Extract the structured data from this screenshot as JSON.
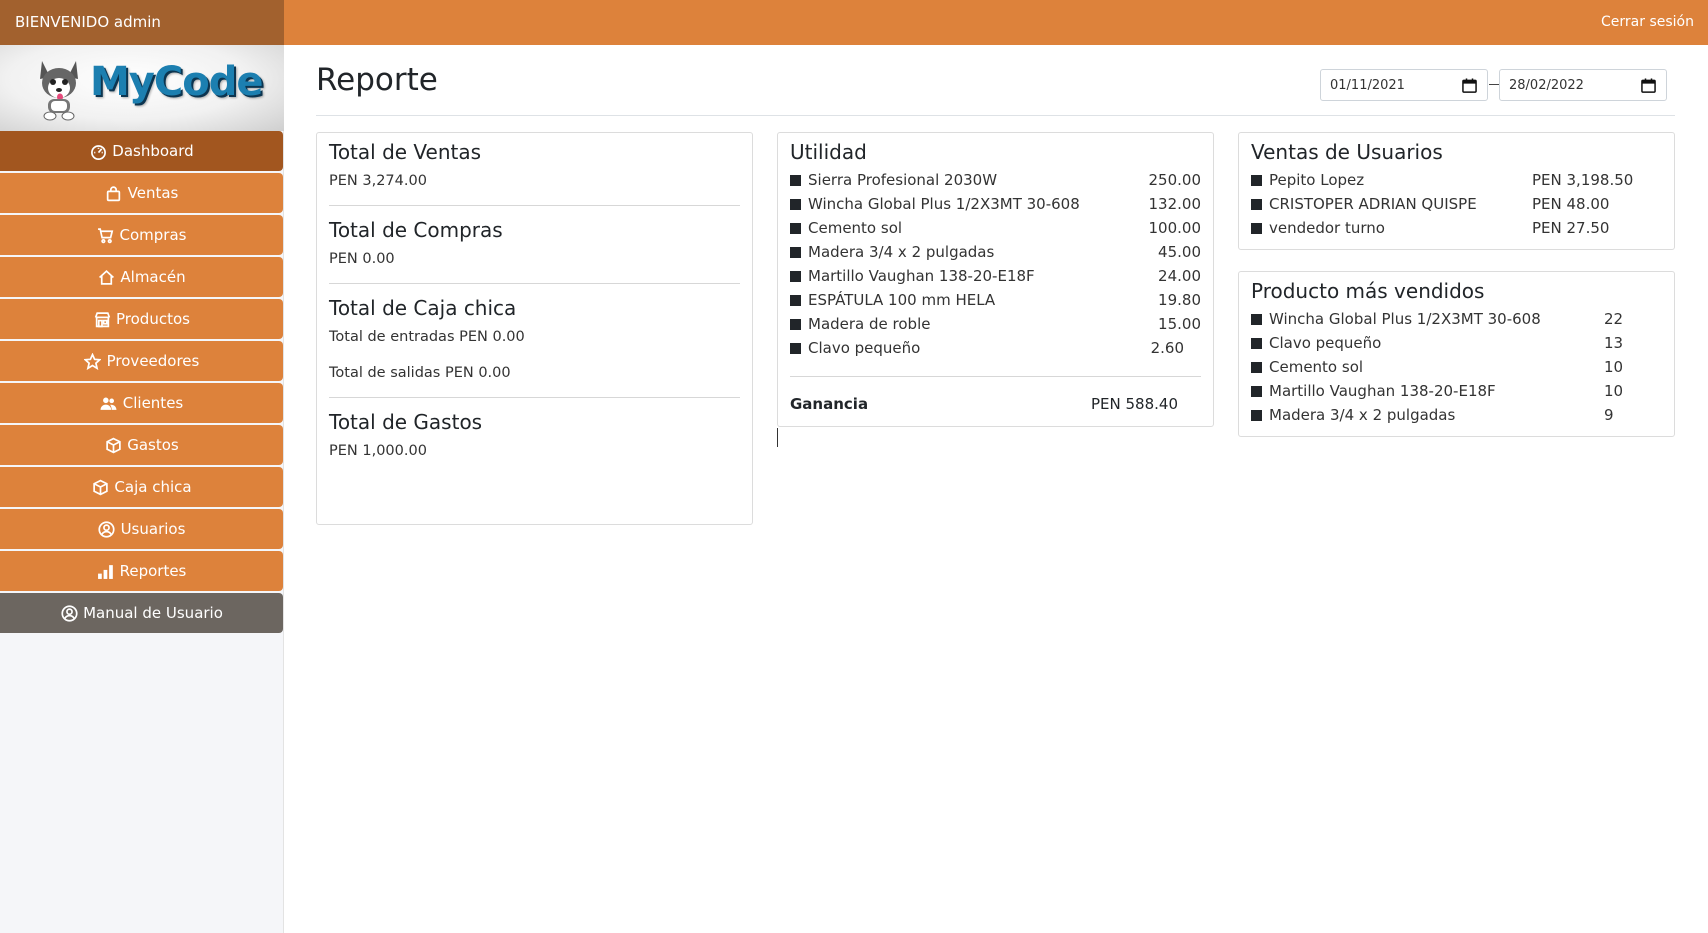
{
  "topbar": {
    "welcome": "BIENVENIDO admin",
    "logout": "Cerrar sesión"
  },
  "logo": {
    "text": "MyCode"
  },
  "sidebar": {
    "items": [
      {
        "label": "Dashboard",
        "icon": "dashboard-icon"
      },
      {
        "label": "Ventas",
        "icon": "bag-icon"
      },
      {
        "label": "Compras",
        "icon": "cart-icon"
      },
      {
        "label": "Almacén",
        "icon": "house-icon"
      },
      {
        "label": "Productos",
        "icon": "shop-icon"
      },
      {
        "label": "Proveedores",
        "icon": "star-icon"
      },
      {
        "label": "Clientes",
        "icon": "people-icon"
      },
      {
        "label": "Gastos",
        "icon": "box-icon"
      },
      {
        "label": "Caja chica",
        "icon": "box-icon"
      },
      {
        "label": "Usuarios",
        "icon": "person-circle-icon"
      },
      {
        "label": "Reportes",
        "icon": "bar-chart-icon"
      },
      {
        "label": "Manual de Usuario",
        "icon": "person-circle-icon"
      }
    ]
  },
  "page": {
    "title": "Reporte",
    "date_from": "01/11/2021",
    "date_to": "28/02/2022"
  },
  "totals": {
    "ventas": {
      "title": "Total de Ventas",
      "value": "PEN 3,274.00"
    },
    "compras": {
      "title": "Total de Compras",
      "value": "PEN 0.00"
    },
    "caja": {
      "title": "Total de Caja chica",
      "entradas": "Total de entradas PEN 0.00",
      "salidas": "Total de salidas PEN 0.00"
    },
    "gastos": {
      "title": "Total de Gastos",
      "value": "PEN 1,000.00"
    }
  },
  "utilidad": {
    "title": "Utilidad",
    "items": [
      {
        "name": "Sierra Profesional 2030W",
        "amount": "250.00"
      },
      {
        "name": "Wincha Global Plus 1/2X3MT 30-608",
        "amount": "132.00"
      },
      {
        "name": "Cemento sol",
        "amount": "100.00"
      },
      {
        "name": "Madera 3/4 x 2 pulgadas",
        "amount": "45.00"
      },
      {
        "name": "Martillo Vaughan 138-20-E18F",
        "amount": "24.00"
      },
      {
        "name": "ESPÁTULA 100 mm HELA",
        "amount": "19.80"
      },
      {
        "name": "Madera de roble",
        "amount": "15.00"
      },
      {
        "name": "Clavo pequeño",
        "amount": "2.60"
      }
    ],
    "ganancia_label": "Ganancia",
    "ganancia_value": "PEN 588.40"
  },
  "ventas_usuarios": {
    "title": "Ventas de Usuarios",
    "items": [
      {
        "name": "Pepito Lopez",
        "amount": "PEN 3,198.50"
      },
      {
        "name": "CRISTOPER ADRIAN QUISPE",
        "amount": "PEN 48.00"
      },
      {
        "name": "vendedor turno",
        "amount": "PEN 27.50"
      }
    ]
  },
  "mas_vendidos": {
    "title": "Producto más vendidos",
    "items": [
      {
        "name": "Wincha Global Plus 1/2X3MT 30-608",
        "qty": "22"
      },
      {
        "name": "Clavo pequeño",
        "qty": "13"
      },
      {
        "name": "Cemento sol",
        "qty": "10"
      },
      {
        "name": "Martillo Vaughan 138-20-E18F",
        "qty": "10"
      },
      {
        "name": "Madera 3/4 x 2 pulgadas",
        "qty": "9"
      }
    ]
  },
  "colors": {
    "accent": "#dd823b",
    "accent_dark": "#a2612e",
    "active": "#a2561f",
    "manual": "#6c6660",
    "logo_blue": "#1c7fb0"
  }
}
